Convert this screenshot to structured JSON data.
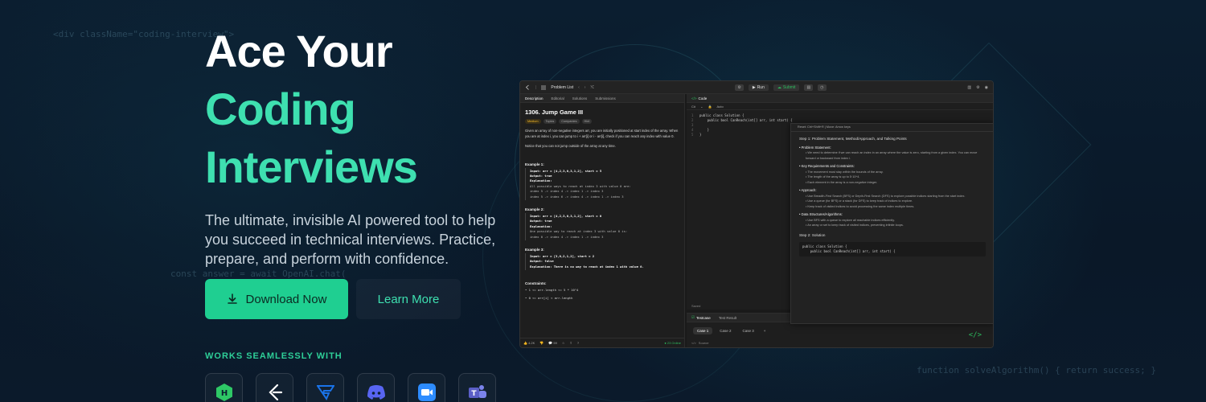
{
  "background": {
    "code_snippets": [
      "<div className=\"coding-interview\">",
      "const answer = await OpenAI.chat(",
      "function solveAlgorithm() { return success; }"
    ]
  },
  "hero": {
    "title_line1": "Ace Your",
    "title_line2": "Coding",
    "title_line3": "Interviews",
    "subtitle": "The ultimate, invisible AI powered tool to help you succeed in technical interviews. Practice, prepare, and perform with confidence.",
    "download_label": "Download Now",
    "learn_more_label": "Learn More",
    "works_label": "WORKS SEAMLESSLY WITH",
    "colors": {
      "accent": "#3ee0b0",
      "button": "#1fcf91"
    }
  },
  "integrations": [
    {
      "name": "hackerrank-logo-icon",
      "color": "#2ec866"
    },
    {
      "name": "leetcode-logo-icon",
      "color": "#ffffff"
    },
    {
      "name": "codesignal-logo-icon",
      "color": "#1a73e8"
    },
    {
      "name": "discord-logo-icon",
      "color": "#5865f2"
    },
    {
      "name": "zoom-logo-icon",
      "color": "#2d8cff"
    },
    {
      "name": "teams-logo-icon",
      "color": "#5b5fc7"
    }
  ],
  "app": {
    "topbar": {
      "problem_list": "Problem List",
      "run": "Run",
      "submit": "Submit"
    },
    "tabs": [
      "Description",
      "Editorial",
      "Solutions",
      "Submissions"
    ],
    "problem": {
      "title": "1306. Jump Game III",
      "difficulty": "Medium",
      "chips": [
        "Topics",
        "Companies",
        "Hint"
      ],
      "desc1": "Given an array of non-negative integers arr, you are initially positioned at start index of the array. When you are at index i, you can jump to i + arr[i] or i - arr[i], check if you can reach any index with value 0.",
      "desc2": "Notice that you can not jump outside of the array at any time.",
      "examples": [
        {
          "label": "Example 1:",
          "input": "Input: arr = [4,2,3,0,3,1,2], start = 5",
          "output": "Output: true",
          "expl": "Explanation:",
          "body": "All possible ways to reach at index 3 with value 0 are:\nindex 5 -> index 4 -> index 1 -> index 3\nindex 5 -> index 6 -> index 4 -> index 1 -> index 3"
        },
        {
          "label": "Example 2:",
          "input": "Input: arr = [4,2,3,0,3,1,2], start = 0",
          "output": "Output: true",
          "expl": "Explanation:",
          "body": "One possible way to reach at index 3 with value 0 is:\nindex 0 -> index 4 -> index 1 -> index 3"
        },
        {
          "label": "Example 3:",
          "input": "Input: arr = [3,0,2,1,2], start = 2",
          "output": "Output: false",
          "expl": "Explanation: There is no way to reach at index 1 with value 0.",
          "body": ""
        }
      ],
      "constraints_label": "Constraints:",
      "constraints": [
        "1 <= arr.length <= 5 * 10^4",
        "0 <= arr[i] < arr.length"
      ],
      "likes": "4.2K",
      "comments": "59",
      "online": "23 Online"
    },
    "code": {
      "tab": "Code",
      "lang": "C#",
      "auto": "Auto",
      "lines": [
        "public class Solution {",
        "    public bool CanReach(int[] arr, int start) {",
        "",
        "    }",
        "}"
      ],
      "saved": "Saved"
    },
    "overlay": {
      "header": "Reset: Ctrl+Shift+R | Move: Arrow keys",
      "step1": "Step 1: Problem Statement, Method/Approach, and Talking Points",
      "sections": [
        {
          "title": "Problem Statement:",
          "items": [
            "We need to determine if we can reach an index in an array where the value is zero, starting from a given index. You can move forward or backward from index i."
          ]
        },
        {
          "title": "Key Requirements and Constraints:",
          "items": [
            "The movement must stay within the bounds of the array.",
            "The length of the array is up to 5·10^4.",
            "Each element in the array is a non-negative integer."
          ]
        },
        {
          "title": "Approach:",
          "items": [
            "Use Breadth-First Search (BFS) or Depth-First Search (DFS) to explore possible indices starting from the start index.",
            "Use a queue (for BFS) or a stack (for DFS) to keep track of indices to explore.",
            "Keep track of visited indices to avoid processing the same index multiple times."
          ]
        },
        {
          "title": "Data Structures/Algorithms:",
          "items": [
            "Use BFS with a queue to explore all reachable indices efficiently.",
            "An array or set to keep track of visited indices, preventing infinite loops."
          ]
        }
      ],
      "step2": "Step 2: Solution",
      "sol_lines": [
        "public class Solution {",
        "    public bool CanReach(int[] arr, int start) {"
      ]
    },
    "testcase": {
      "tab1": "Testcase",
      "tab2": "Test Result",
      "cases": [
        "Case 1",
        "Case 2",
        "Case 3"
      ],
      "add": "+",
      "source": "Source"
    }
  }
}
